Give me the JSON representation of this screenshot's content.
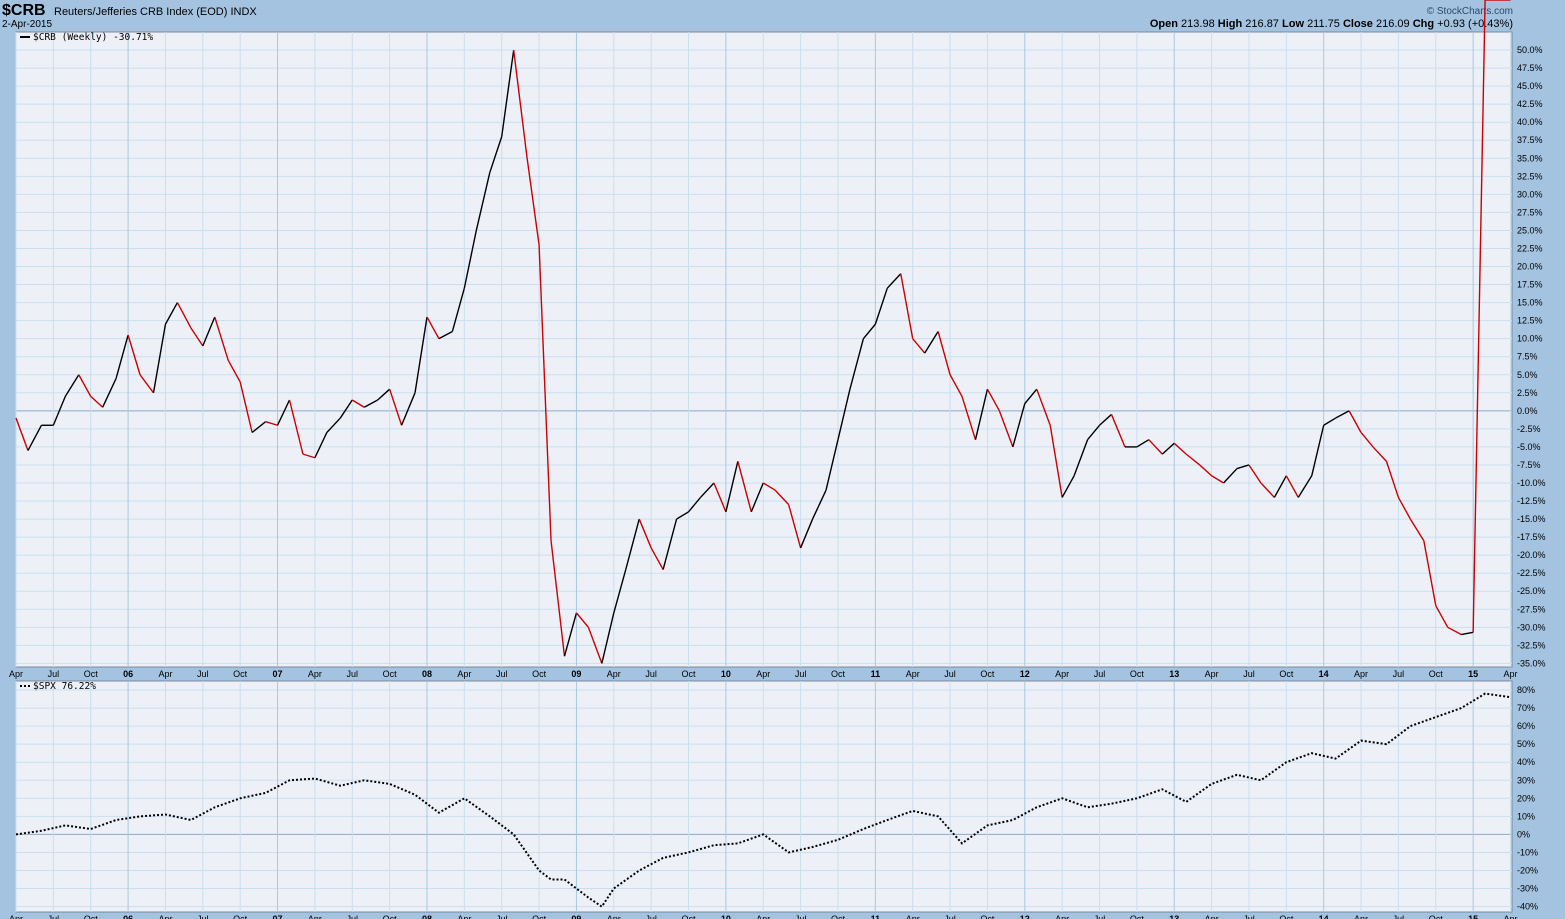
{
  "header": {
    "symbol": "$CRB",
    "description": "Reuters/Jefferies CRB Index (EOD)",
    "exchange": "INDX",
    "date": "2-Apr-2015",
    "watermark": "© StockCharts.com",
    "open_label": "Open",
    "open": "213.98",
    "high_label": "High",
    "high": "216.87",
    "low_label": "Low",
    "low": "211.75",
    "close_label": "Close",
    "close": "216.09",
    "chg_label": "Chg",
    "chg": "+0.93 (+0.43%)"
  },
  "chart_data": [
    {
      "type": "line",
      "panel": "main",
      "legend": "$CRB (Weekly) -30.71%",
      "ylim": [
        -35.5,
        52.5
      ],
      "yticks": [
        50,
        47.5,
        45,
        42.5,
        40,
        37.5,
        35,
        32.5,
        30,
        27.5,
        25,
        22.5,
        20,
        17.5,
        15,
        12.5,
        10,
        7.5,
        5,
        2.5,
        0,
        -2.5,
        -5,
        -7.5,
        -10,
        -12.5,
        -15,
        -17.5,
        -20,
        -22.5,
        -25,
        -27.5,
        -30,
        -32.5,
        -35
      ],
      "ytick_labels": [
        "50.0%",
        "47.5%",
        "45.0%",
        "42.5%",
        "40.0%",
        "37.5%",
        "35.0%",
        "32.5%",
        "30.0%",
        "27.5%",
        "25.0%",
        "22.5%",
        "20.0%",
        "17.5%",
        "15.0%",
        "12.5%",
        "10.0%",
        "7.5%",
        "5.0%",
        "2.5%",
        "0.0%",
        "-2.5%",
        "-5.0%",
        "-7.5%",
        "-10.0%",
        "-12.5%",
        "-15.0%",
        "-17.5%",
        "-20.0%",
        "-22.5%",
        "-25.0%",
        "-27.5%",
        "-30.0%",
        "-32.5%",
        "-35.0%"
      ],
      "up_color": "#000000",
      "down_color": "#cc0000",
      "x": [
        2005.25,
        2005.33,
        2005.42,
        2005.5,
        2005.58,
        2005.67,
        2005.75,
        2005.83,
        2005.92,
        2006.0,
        2006.08,
        2006.17,
        2006.25,
        2006.33,
        2006.42,
        2006.5,
        2006.58,
        2006.67,
        2006.75,
        2006.83,
        2006.92,
        2007.0,
        2007.08,
        2007.17,
        2007.25,
        2007.33,
        2007.42,
        2007.5,
        2007.58,
        2007.67,
        2007.75,
        2007.83,
        2007.92,
        2008.0,
        2008.08,
        2008.17,
        2008.25,
        2008.33,
        2008.42,
        2008.5,
        2008.58,
        2008.67,
        2008.75,
        2008.83,
        2008.92,
        2009.0,
        2009.08,
        2009.17,
        2009.25,
        2009.33,
        2009.42,
        2009.5,
        2009.58,
        2009.67,
        2009.75,
        2009.83,
        2009.92,
        2010.0,
        2010.08,
        2010.17,
        2010.25,
        2010.33,
        2010.42,
        2010.5,
        2010.58,
        2010.67,
        2010.75,
        2010.83,
        2010.92,
        2011.0,
        2011.08,
        2011.17,
        2011.25,
        2011.33,
        2011.42,
        2011.5,
        2011.58,
        2011.67,
        2011.75,
        2011.83,
        2011.92,
        2012.0,
        2012.08,
        2012.17,
        2012.25,
        2012.33,
        2012.42,
        2012.5,
        2012.58,
        2012.67,
        2012.75,
        2012.83,
        2012.92,
        2013.0,
        2013.08,
        2013.17,
        2013.25,
        2013.33,
        2013.42,
        2013.5,
        2013.58,
        2013.67,
        2013.75,
        2013.83,
        2013.92,
        2014.0,
        2014.08,
        2014.17,
        2014.25,
        2014.33,
        2014.42,
        2014.5,
        2014.58,
        2014.67,
        2014.75,
        2014.83,
        2014.92,
        2015.0,
        2015.08,
        2015.17,
        2015.25
      ],
      "values": [
        -1,
        -5.5,
        -2,
        -2,
        2,
        5,
        2,
        0.5,
        4.5,
        10.5,
        5,
        2.5,
        12,
        15,
        11.5,
        9,
        13,
        7,
        4,
        -3,
        -1.5,
        -2,
        1.5,
        -6,
        -6.5,
        -3,
        -1,
        1.5,
        0.5,
        1.5,
        3,
        -2,
        2.5,
        13,
        10,
        11,
        17,
        25,
        33,
        38,
        50,
        35,
        23,
        -18,
        -34,
        -28,
        -30,
        -35,
        -28,
        -22,
        -15,
        -19,
        -22,
        -15,
        -14,
        -12,
        -10,
        -14,
        -7,
        -14,
        -10,
        -11,
        -13,
        -19,
        -15,
        -11,
        -4,
        3,
        10,
        12,
        17,
        19,
        10,
        8,
        11,
        5,
        2,
        -4,
        3,
        0,
        -5,
        1,
        3,
        -2,
        -12,
        -9,
        -4,
        -2,
        -0.5,
        -5,
        -5,
        -4,
        -6,
        -4.5,
        -6,
        -7.5,
        -9,
        -10,
        -8,
        -7.5,
        -10,
        -12,
        -9,
        -12,
        -9,
        -2,
        -1,
        0,
        -3,
        -5,
        -7,
        -12,
        -15,
        -18,
        -27,
        -30,
        -31,
        -30.7
      ]
    },
    {
      "type": "line",
      "panel": "lower",
      "legend": "$SPX 76.22%",
      "ylim": [
        -43,
        85
      ],
      "yticks": [
        80,
        70,
        60,
        50,
        40,
        30,
        20,
        10,
        0,
        -10,
        -20,
        -30,
        -40
      ],
      "ytick_labels": [
        "80%",
        "70%",
        "60%",
        "50%",
        "40%",
        "30%",
        "20%",
        "10%",
        "0%",
        "-10%",
        "-20%",
        "-30%",
        "-40%"
      ],
      "x": [
        2005.25,
        2005.42,
        2005.58,
        2005.75,
        2005.92,
        2006.08,
        2006.25,
        2006.42,
        2006.58,
        2006.75,
        2006.92,
        2007.08,
        2007.25,
        2007.42,
        2007.58,
        2007.75,
        2007.92,
        2008.08,
        2008.25,
        2008.42,
        2008.58,
        2008.75,
        2008.83,
        2008.92,
        2009.08,
        2009.17,
        2009.25,
        2009.42,
        2009.58,
        2009.75,
        2009.92,
        2010.08,
        2010.25,
        2010.42,
        2010.58,
        2010.75,
        2010.92,
        2011.08,
        2011.25,
        2011.42,
        2011.58,
        2011.75,
        2011.92,
        2012.08,
        2012.25,
        2012.42,
        2012.58,
        2012.75,
        2012.92,
        2013.08,
        2013.25,
        2013.42,
        2013.58,
        2013.75,
        2013.92,
        2014.08,
        2014.25,
        2014.42,
        2014.58,
        2014.75,
        2014.92,
        2015.08,
        2015.25
      ],
      "values": [
        0,
        2,
        5,
        3,
        8,
        10,
        11,
        8,
        15,
        20,
        23,
        30,
        31,
        27,
        30,
        28,
        22,
        12,
        20,
        10,
        0,
        -20,
        -25,
        -25,
        -35,
        -40,
        -30,
        -20,
        -13,
        -10,
        -6,
        -5,
        0,
        -10,
        -7,
        -3,
        3,
        8,
        13,
        10,
        -5,
        5,
        8,
        15,
        20,
        15,
        17,
        20,
        25,
        18,
        28,
        33,
        30,
        40,
        45,
        42,
        52,
        50,
        60,
        65,
        70,
        78,
        76
      ]
    }
  ],
  "xaxis": {
    "labels": [
      "Apr",
      "Jul",
      "Oct",
      "06",
      "Apr",
      "Jul",
      "Oct",
      "07",
      "Apr",
      "Jul",
      "Oct",
      "08",
      "Apr",
      "Jul",
      "Oct",
      "09",
      "Apr",
      "Jul",
      "Oct",
      "10",
      "Apr",
      "Jul",
      "Oct",
      "11",
      "Apr",
      "Jul",
      "Oct",
      "12",
      "Apr",
      "Jul",
      "Oct",
      "13",
      "Apr",
      "Jul",
      "Oct",
      "14",
      "Apr",
      "Jul",
      "Oct",
      "15",
      "Apr"
    ]
  }
}
